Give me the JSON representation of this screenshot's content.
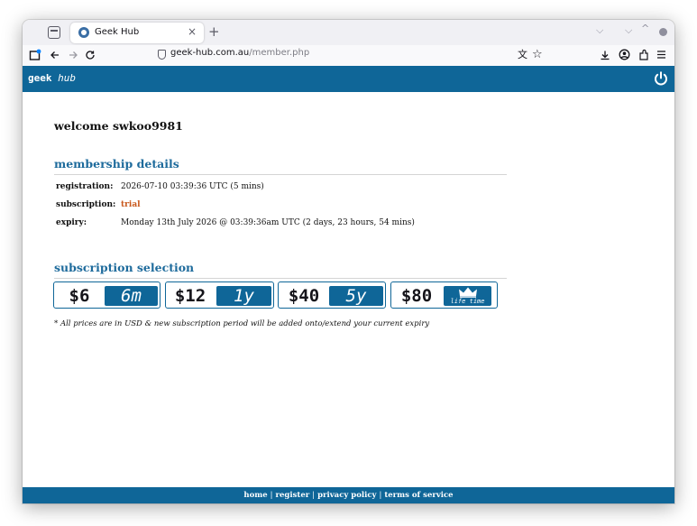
{
  "browser": {
    "tab_title": "Geek Hub",
    "tab_close": "×",
    "new_tab": "+",
    "url_domain": "geek-hub.com.au",
    "url_path": "/member.php",
    "icons": [
      "tab-list-icon",
      "favicon-icon",
      "close-icon",
      "plus-icon",
      "back-arrow-icon",
      "forward-arrow-icon",
      "reload-icon",
      "shield-icon",
      "translate-icon",
      "bookmark-star-icon",
      "download-icon",
      "account-icon",
      "extensions-icon",
      "menu-icon",
      "chevron-down-icon",
      "chevron-up-icon"
    ]
  },
  "header": {
    "logo_geek": "geek",
    "logo_hub": "hub",
    "power_icon": "power-icon"
  },
  "main": {
    "welcome": "welcome swkoo9981",
    "membership_title": "membership details",
    "details": [
      {
        "label": "registration:",
        "value": "2026-07-10 03:39:36 UTC (5 mins)"
      },
      {
        "label": "subscription:",
        "value": "trial"
      },
      {
        "label": "expiry:",
        "value": "Monday 13th July 2026 @ 03:39:36am UTC (2 days, 23 hours, 54 mins)"
      }
    ],
    "subscription_title": "subscription selection",
    "plans": [
      {
        "price": "$6",
        "period": "6m"
      },
      {
        "price": "$12",
        "period": "1y"
      },
      {
        "price": "$40",
        "period": "5y"
      },
      {
        "price": "$80",
        "period": "life time"
      }
    ],
    "note": "* All prices are in USD & new subscription period will be added onto/extend your current expiry"
  },
  "footer": {
    "links": [
      "home",
      "register",
      "privacy policy",
      "terms of service"
    ],
    "separator": "|"
  },
  "colors": {
    "brand_blue": "#0f6698",
    "heading_blue": "#1e6b9c",
    "trial_orange": "#c8571b"
  }
}
